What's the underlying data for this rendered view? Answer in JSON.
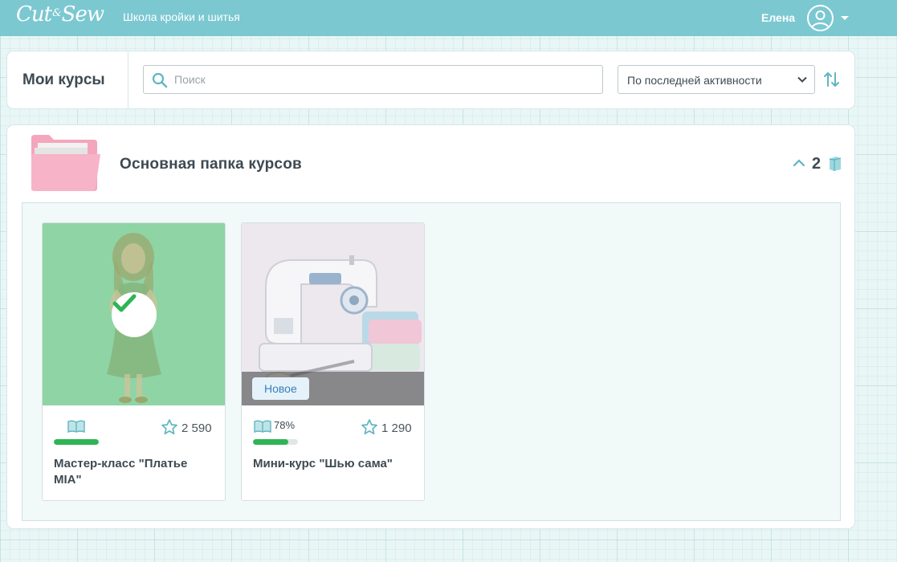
{
  "header": {
    "logo_text_left": "Cut",
    "logo_amp": "&",
    "logo_text_right": "Sew",
    "tagline": "Школа кройки и шитья",
    "user_name": "Елена"
  },
  "toolbar": {
    "title": "Мои курсы",
    "search_placeholder": "Поиск",
    "sort_selected": "По последней активности"
  },
  "folder": {
    "title": "Основная папка курсов",
    "count": "2"
  },
  "courses": [
    {
      "title": "Мастер-класс \"Платье MIA\"",
      "progress_percent": 100,
      "views": "2 590",
      "completed": true
    },
    {
      "title": "Мини-курс \"Шью сама\"",
      "progress_label": "78%",
      "progress_percent": 78,
      "views": "1 290",
      "badge": "Новое"
    }
  ],
  "colors": {
    "header_bg": "#7cc8d1",
    "accent_teal": "#5fb6c2",
    "progress_green": "#2fb455",
    "completed_overlay": "#8fd4a5",
    "folder_pink": "#f4a6bd"
  },
  "icons": {
    "search": "search-icon",
    "sort_toggle": "sort-arrows-icon",
    "collapse": "chevron-up-icon",
    "book": "book-icon",
    "star": "star-icon",
    "check": "checkmark-icon",
    "folder": "folder-icon",
    "avatar": "user-avatar-icon"
  }
}
